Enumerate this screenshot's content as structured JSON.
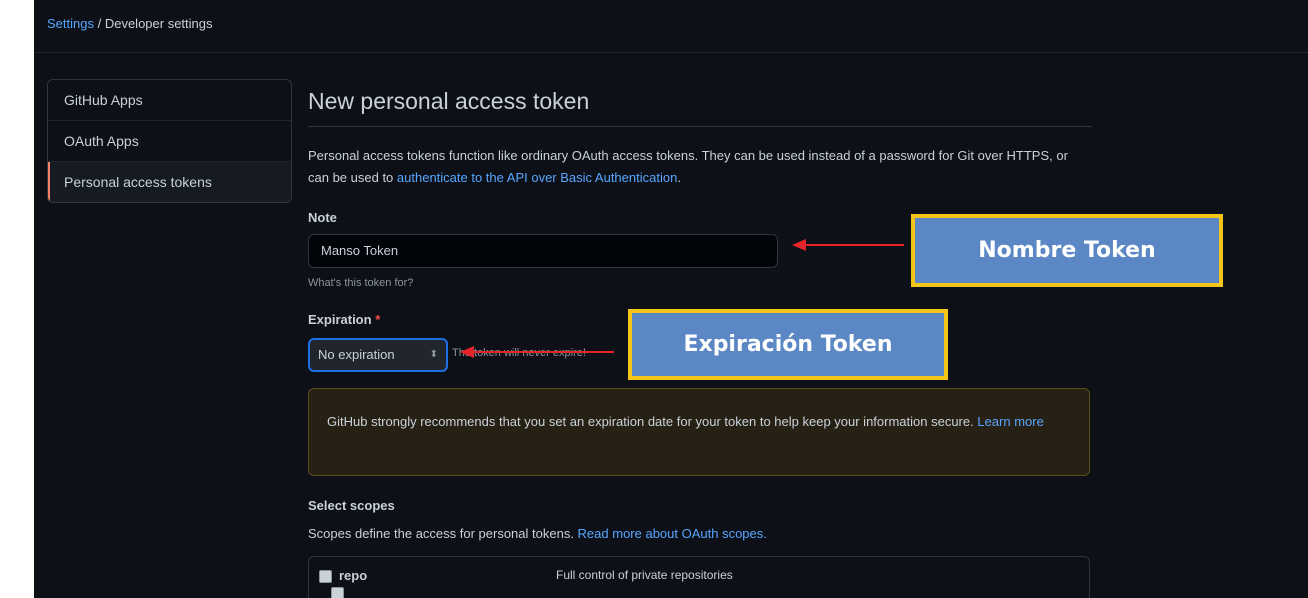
{
  "breadcrumb": {
    "root": "Settings",
    "separator": " / ",
    "current": "Developer settings"
  },
  "sidebar": {
    "items": [
      {
        "label": "GitHub Apps",
        "active": false
      },
      {
        "label": "OAuth Apps",
        "active": false
      },
      {
        "label": "Personal access tokens",
        "active": true
      }
    ]
  },
  "main": {
    "title": "New personal access token",
    "description_text": "Personal access tokens function like ordinary OAuth access tokens. They can be used instead of a password for Git over HTTPS, or can be used to ",
    "description_link": "authenticate to the API over Basic Authentication",
    "description_end": ".",
    "note": {
      "label": "Note",
      "value": "Manso Token",
      "help": "What's this token for?"
    },
    "expiration": {
      "label": "Expiration",
      "required_mark": "*",
      "selected": "No expiration",
      "hint": "The token will never expire!"
    },
    "warning": {
      "text": "GitHub strongly recommends that you set an expiration date for your token to help keep your information secure. ",
      "link": "Learn more"
    },
    "scopes": {
      "title": "Select scopes",
      "description": "Scopes define the access for personal tokens. ",
      "link": "Read more about OAuth scopes.",
      "items": [
        {
          "name": "repo",
          "description": "Full control of private repositories",
          "checked": false
        }
      ]
    }
  },
  "annotations": {
    "nombre": "Nombre Token",
    "expiracion": "Expiración Token",
    "box_fill": "#5b87c4",
    "box_border": "#f5c518",
    "arrow_color": "#e5242a"
  }
}
